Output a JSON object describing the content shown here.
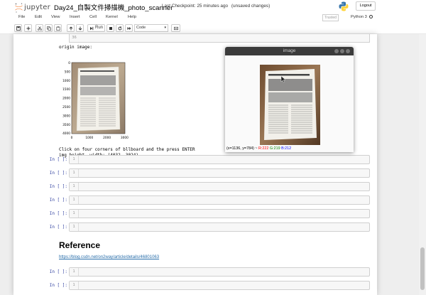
{
  "header": {
    "logo_text": "jupyter",
    "notebook_title": "Day24_自製文件掃描機_photo_scanner",
    "checkpoint": "Last Checkpoint: 25 minutes ago",
    "unsaved": "(unsaved changes)",
    "logout_label": "Logout"
  },
  "menu": {
    "items": [
      "File",
      "Edit",
      "View",
      "Insert",
      "Cell",
      "Kernel",
      "Help"
    ]
  },
  "status": {
    "trusted": "Trusted",
    "kernel": "Python 3"
  },
  "toolbar": {
    "run_label": "Run",
    "cell_type": "Code"
  },
  "cells": {
    "prev_output_count": "36",
    "output_origin_label": "origin image:",
    "plot": {
      "y_ticks": [
        "0",
        "500",
        "1000",
        "1500",
        "2000",
        "2500",
        "3000",
        "3500",
        "4000"
      ],
      "x_ticks": [
        "0",
        "1000",
        "2000",
        "3000"
      ]
    },
    "output_instruction": "Click on four corners of bllboard and the press ENTER",
    "output_dims": "img height, width: (4032, 3024)",
    "empty_prompt": "In [ ]:",
    "line_number": "1"
  },
  "reference": {
    "heading": "Reference",
    "link": "https://blog.csdn.net/on2way/article/details/46801063"
  },
  "popup": {
    "title": "image",
    "coords": "(x=1136, y=784) ~",
    "r": "R:222",
    "g": "G:219",
    "b": "B:212",
    "r_color": "#ff0000",
    "g_color": "#008000",
    "b_color": "#0000ff"
  },
  "colors": {
    "prompt": "#303f9f",
    "link": "#296eaa",
    "jupyter_orange": "#f37726"
  }
}
